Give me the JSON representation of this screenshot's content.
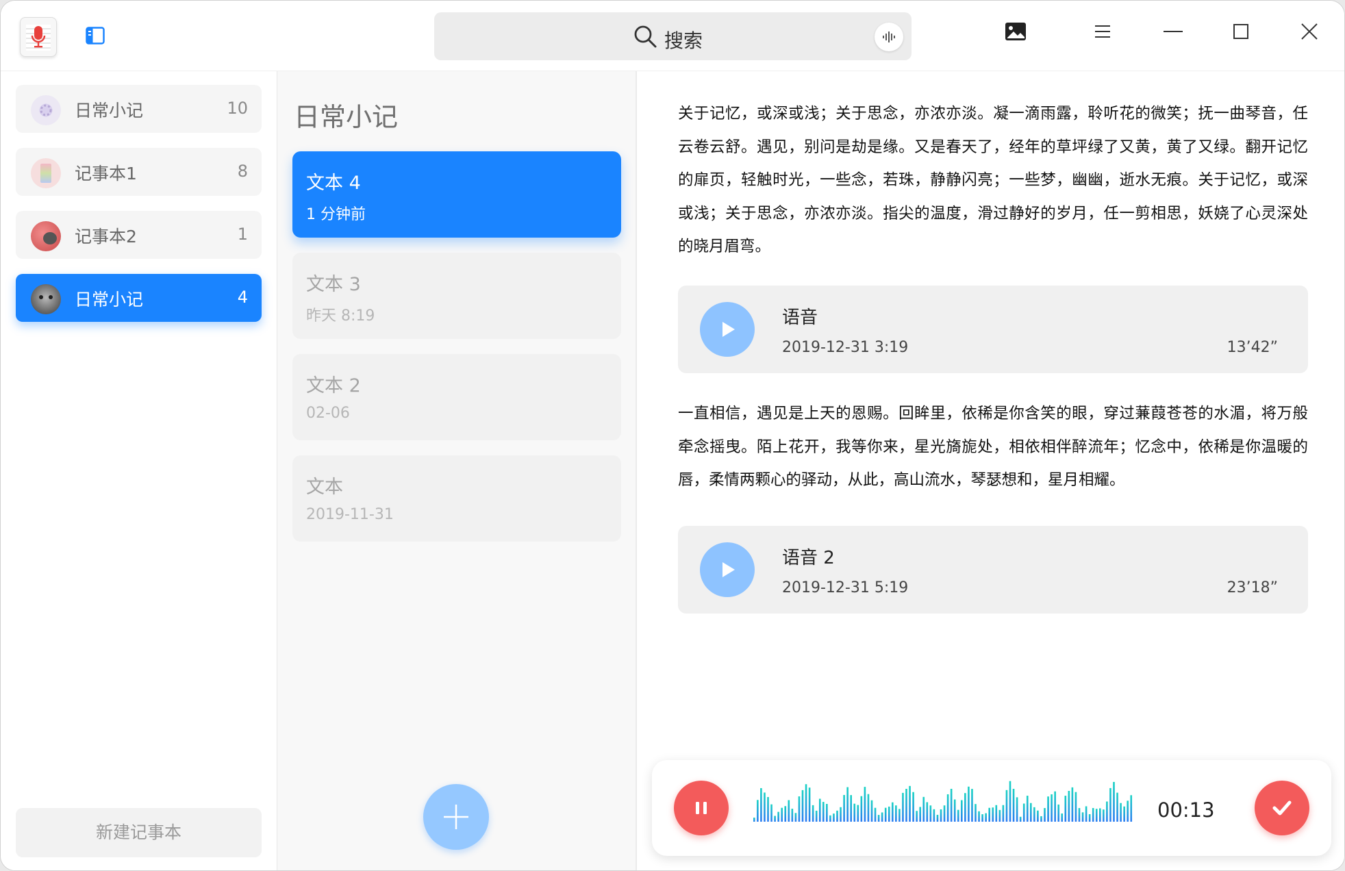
{
  "header": {
    "search_label": "搜索"
  },
  "sidebar": {
    "notebooks": [
      {
        "name": "日常小记",
        "count": "10"
      },
      {
        "name": "记事本1",
        "count": "8"
      },
      {
        "name": "记事本2",
        "count": "1"
      },
      {
        "name": "日常小记",
        "count": "4"
      }
    ],
    "new_notebook_label": "新建记事本"
  },
  "notes_panel": {
    "title": "日常小记",
    "notes": [
      {
        "title": "文本 4",
        "date": "1 分钟前"
      },
      {
        "title": "文本 3",
        "date": "昨天  8:19"
      },
      {
        "title": "文本 2",
        "date": "02-06"
      },
      {
        "title": "文本",
        "date": "2019-11-31"
      }
    ]
  },
  "editor": {
    "paragraph1": "关于记忆，或深或浅；关于思念，亦浓亦淡。凝一滴雨露，聆听花的微笑；抚一曲琴音，任云卷云舒。遇见，别问是劫是缘。又是春天了，经年的草坪绿了又黄，黄了又绿。翻开记忆的扉页，轻触时光，一些念，若珠，静静闪亮；一些梦，幽幽，逝水无痕。关于记忆，或深或浅；关于思念，亦浓亦淡。指尖的温度，滑过静好的岁月，任一剪相思，妖娆了心灵深处的晓月眉弯。",
    "voice1": {
      "title": "语音",
      "date": "2019-12-31  3:19",
      "length": "13’42”"
    },
    "paragraph2": "一直相信，遇见是上天的恩赐。回眸里，依稀是你含笑的眼，穿过蒹葭苍苍的水湄，将万般牵念摇曳。陌上花开，我等你来，星光旖旎处，相依相伴醉流年；忆念中，依稀是你温暖的唇，柔情两颗心的驿动，从此，高山流水，琴瑟想和，星月相耀。",
    "voice2": {
      "title": "语音 2",
      "date": "2019-12-31  5:19",
      "length": "23’18”"
    }
  },
  "recorder": {
    "elapsed": "00:13"
  },
  "colors": {
    "accent": "#1a84ff",
    "record_red": "#f35b5b",
    "play_blue": "#8ec3ff"
  }
}
